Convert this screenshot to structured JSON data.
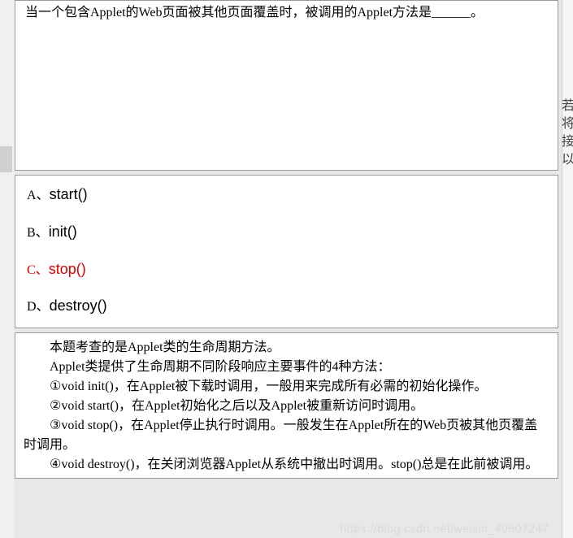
{
  "question": {
    "text": "当一个包含Applet的Web页面被其他页面覆盖时，被调用的Applet方法是______。"
  },
  "choices": {
    "a": {
      "prefix": "A、",
      "text": "start()"
    },
    "b": {
      "prefix": "B、",
      "text": "init()"
    },
    "c": {
      "prefix": "C、",
      "text": "stop()"
    },
    "d": {
      "prefix": "D、",
      "text": "destroy()"
    }
  },
  "correct_choice": "c",
  "explanation": {
    "lines": [
      "本题考查的是Applet类的生命周期方法。",
      "Applet类提供了生命周期不同阶段响应主要事件的4种方法：",
      "①void init()，在Applet被下载时调用，一般用来完成所有必需的初始化操作。",
      "②void start()，在Applet初始化之后以及Applet被重新访问时调用。",
      "③void stop()，在Applet停止执行时调用。一般发生在Applet所在的Web页被其他页覆盖时调用。",
      "④void destroy()，在关闭浏览器Applet从系统中撤出时调用。stop()总是在此前被调用。"
    ]
  },
  "watermark": "https://blog.csdn.net/weixin_40807247",
  "right_edge_chars": [
    "若",
    "将",
    "接",
    "以"
  ]
}
